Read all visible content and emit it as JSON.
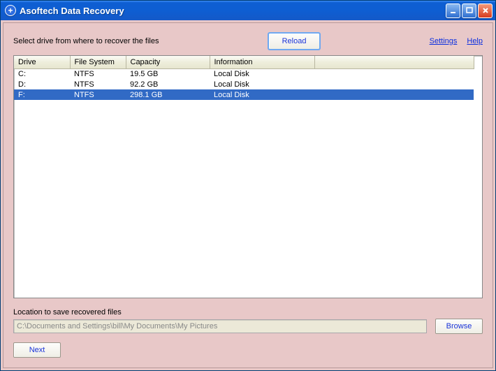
{
  "title": "Asoftech Data Recovery",
  "prompt": "Select drive from where to recover the files",
  "buttons": {
    "reload": "Reload",
    "browse": "Browse",
    "next": "Next"
  },
  "links": {
    "settings": "Settings",
    "help": "Help"
  },
  "columns": {
    "drive": "Drive",
    "fs": "File System",
    "capacity": "Capacity",
    "info": "Information"
  },
  "drives": [
    {
      "drive": "C:",
      "fs": "NTFS",
      "capacity": "19.5 GB",
      "info": "Local Disk",
      "selected": false
    },
    {
      "drive": "D:",
      "fs": "NTFS",
      "capacity": "92.2 GB",
      "info": "Local Disk",
      "selected": false
    },
    {
      "drive": "F:",
      "fs": "NTFS",
      "capacity": "298.1 GB",
      "info": "Local Disk",
      "selected": true
    }
  ],
  "location": {
    "label": "Location to save recovered files",
    "value": "C:\\Documents and Settings\\bill\\My Documents\\My Pictures"
  }
}
